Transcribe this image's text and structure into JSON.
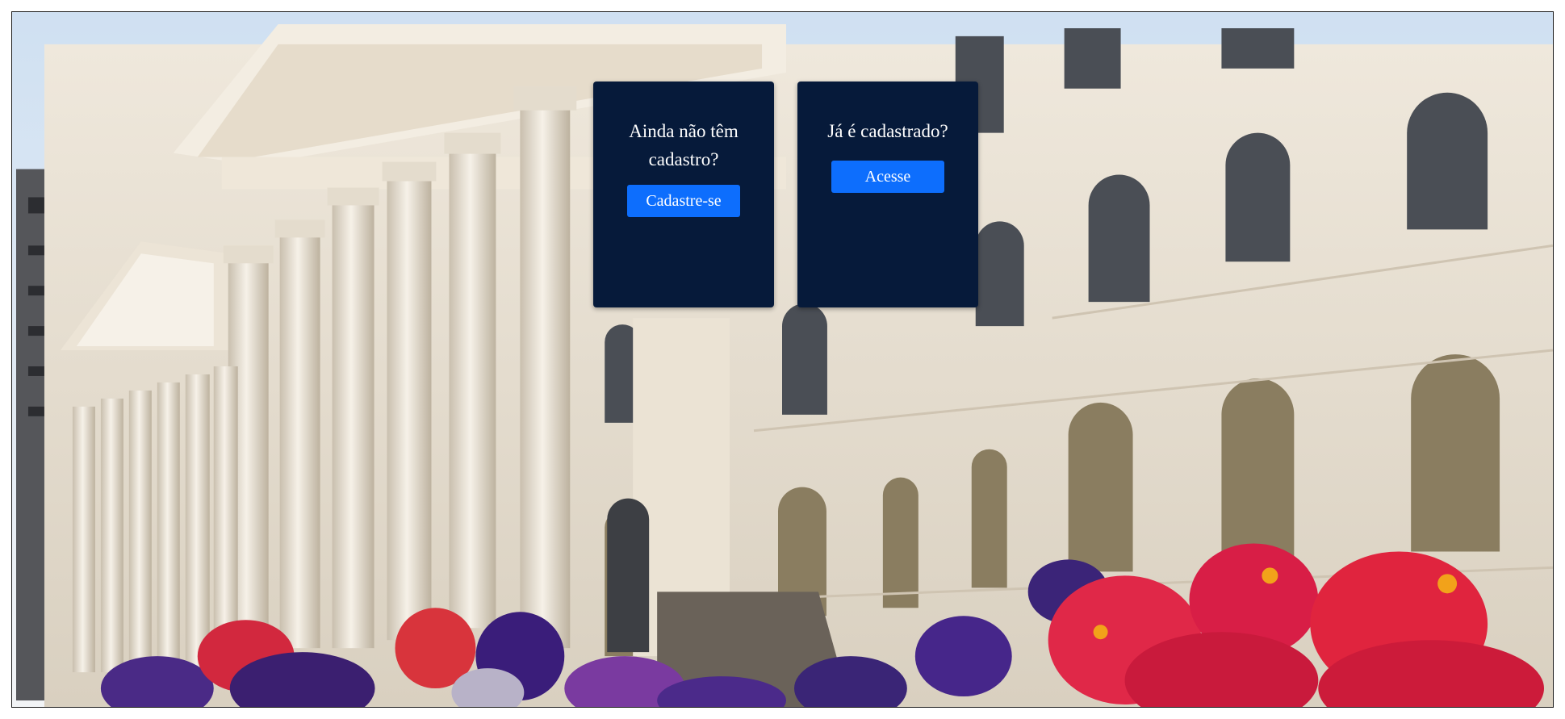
{
  "background": {
    "description_icon": "university-building-photo"
  },
  "signup_card": {
    "question": "Ainda não têm cadastro?",
    "button_label": "Cadastre-se"
  },
  "login_card": {
    "question": "Já é cadastrado?",
    "button_label": "Acesse"
  },
  "colors": {
    "card_bg": "#061a3a",
    "button_bg": "#0d6efd",
    "text": "#ffffff"
  }
}
